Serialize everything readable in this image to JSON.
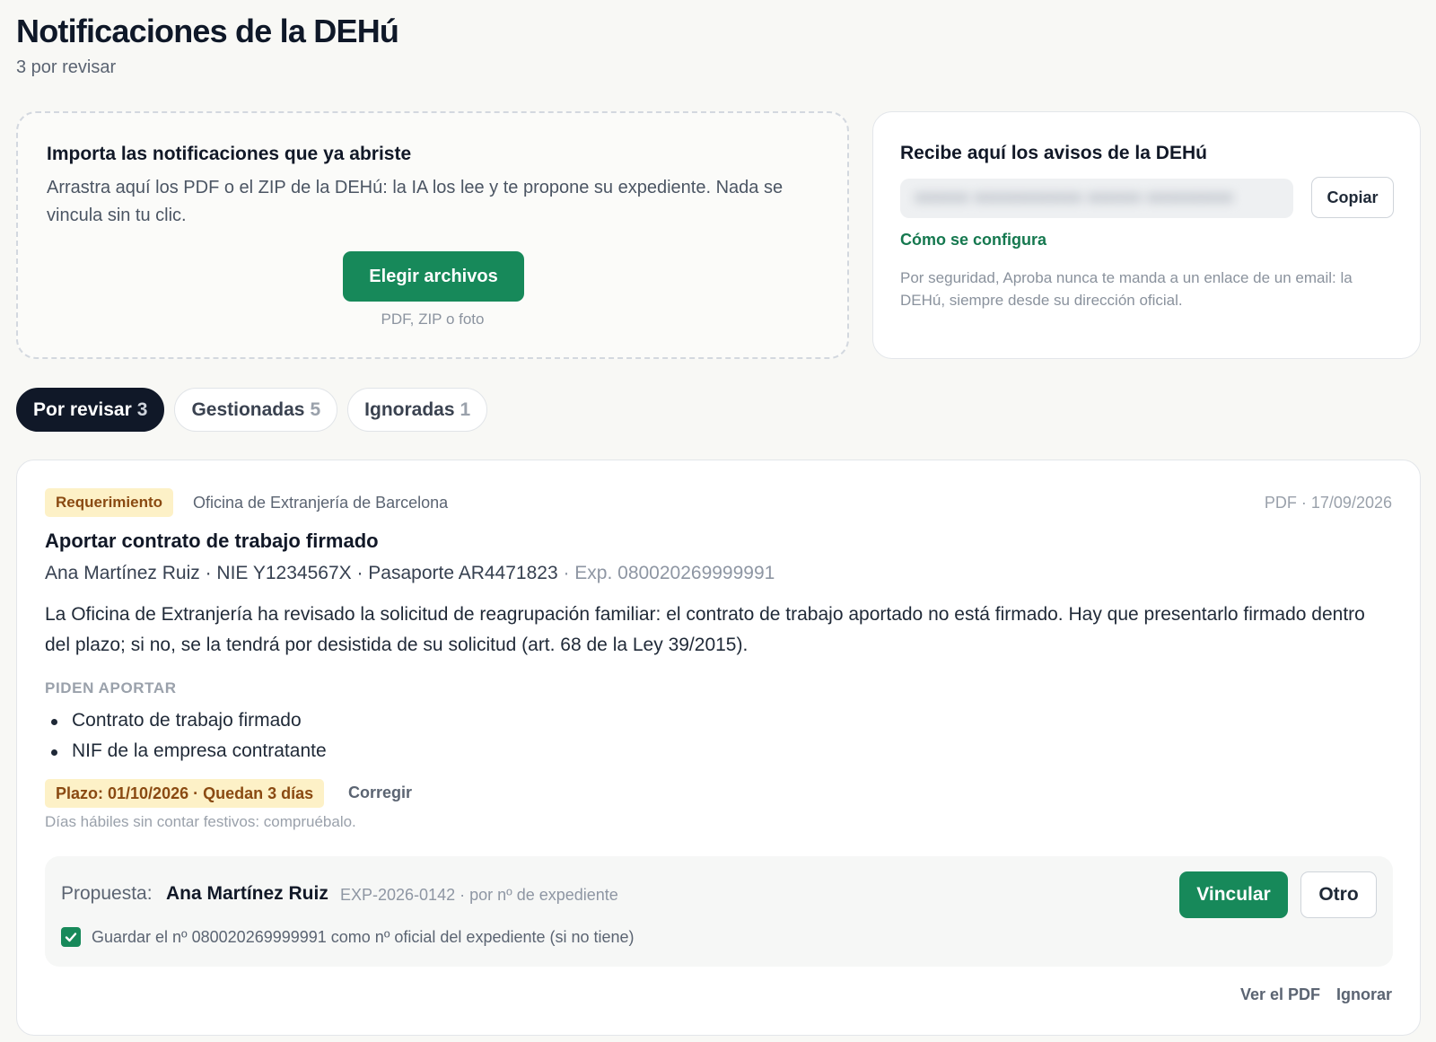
{
  "header": {
    "title": "Notificaciones de la DEHú",
    "subtitle": "3 por revisar"
  },
  "import_card": {
    "title": "Importa las notificaciones que ya abriste",
    "description": "Arrastra aquí los PDF o el ZIP de la DEHú: la IA los lee y te propone su expediente. Nada se vincula sin tu clic.",
    "button_label": "Elegir archivos",
    "hint": "PDF, ZIP o foto"
  },
  "notices_card": {
    "title": "Recibe aquí los avisos de la DEHú",
    "copy_label": "Copiar",
    "config_link": "Cómo se configura",
    "security_note": "Por seguridad, Aproba nunca te manda a un enlace de un email: la DEHú, siempre desde su dirección oficial."
  },
  "tabs": [
    {
      "label": "Por revisar",
      "count": "3",
      "active": true
    },
    {
      "label": "Gestionadas",
      "count": "5",
      "active": false
    },
    {
      "label": "Ignoradas",
      "count": "1",
      "active": false
    }
  ],
  "notification": {
    "type_badge": "Requerimiento",
    "office": "Oficina de Extranjería de Barcelona",
    "meta": "PDF · 17/09/2026",
    "title": "Aportar contrato de trabajo firmado",
    "person": "Ana Martínez Ruiz · NIE Y1234567X · Pasaporte AR4471823",
    "expedient": " · Exp. 080020269999991",
    "description": "La Oficina de Extranjería ha revisado la solicitud de reagrupación familiar: el contrato de trabajo aportado no está firmado. Hay que presentarlo firmado dentro del plazo; si no, se la tendrá por desistida de su solicitud (art. 68 de la Ley 39/2015).",
    "requirements_label": "PIDEN APORTAR",
    "requirements": [
      "Contrato de trabajo firmado",
      "NIF de la empresa contratante"
    ],
    "deadline": "Plazo: 01/10/2026 · Quedan 3 días",
    "correct_label": "Corregir",
    "deadline_note": "Días hábiles sin contar festivos: compruébalo.",
    "proposal": {
      "label": "Propuesta:",
      "name": "Ana Martínez Ruiz",
      "meta": "EXP-2026-0142 · por nº de expediente",
      "link_label": "Vincular",
      "other_label": "Otro",
      "save_text": "Guardar el nº 080020269999991 como nº oficial del expediente (si no tiene)",
      "save_checked": true
    },
    "view_pdf": "Ver el PDF",
    "ignore": "Ignorar"
  },
  "colors": {
    "primary_green": "#17895a",
    "dark": "#101828",
    "badge_bg": "#fdf1c7",
    "badge_text": "#8a4a12"
  }
}
